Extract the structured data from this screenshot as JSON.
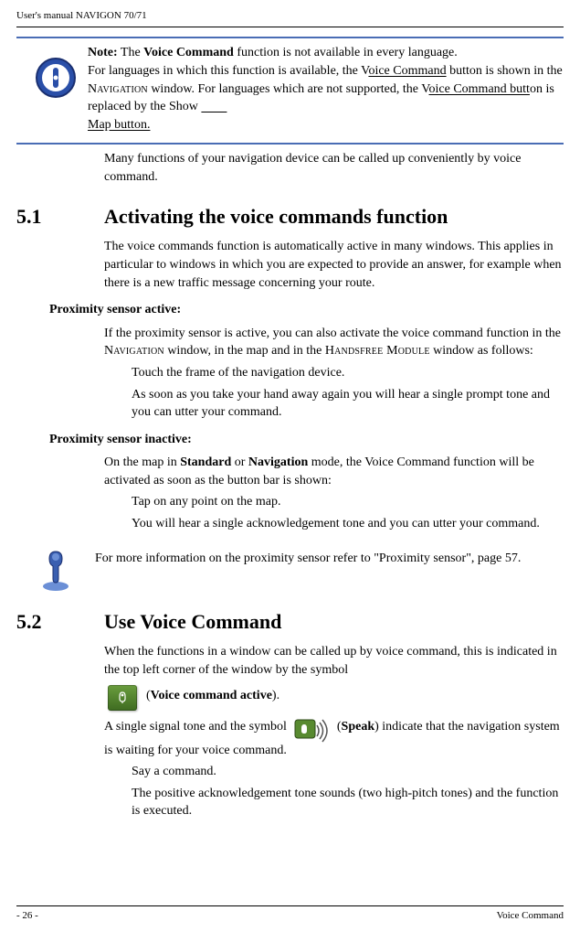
{
  "header": {
    "title": "User's manual NAVIGON 70/71"
  },
  "note": {
    "line1_prefix": "Note:",
    "line1_rest_a": " The ",
    "line1_bold": "Voice Command",
    "line1_rest_b": " function is not available in every language.",
    "line2_a": "For languages in which this function is available, the V",
    "line2_u1": "oice Command",
    "line2_b": " button is shown in the ",
    "line2_sc": "Navigation",
    "line2_c": " window. For languages which are not supported, the V",
    "line2_u2": "oice Command butt",
    "line2_d": "on is replaced by the Show ",
    "line2_spaces": "        ",
    "line2_u3": "Map button."
  },
  "intro_para": "Many functions of your navigation device can be called up conveniently by voice command.",
  "sections": [
    {
      "num": "5.1",
      "title": "Activating the voice commands function",
      "para1": "The voice commands function is automatically active in many windows. This applies in particular to windows in which you are expected to provide an answer, for example when there is a new traffic message concerning your route.",
      "sub1_heading": "Proximity sensor active:",
      "sub1_p1_a": "If the proximity sensor is active, you can also activate the voice command function in the ",
      "sub1_sc1": "Navigation",
      "sub1_p1_b": " window, in the map and in the ",
      "sub1_sc2": "Handsfree Module",
      "sub1_p1_c": " window as follows:",
      "sub1_step1": "Touch the frame of the navigation device.",
      "sub1_step2": "As soon as you take your hand away again you will hear a single prompt tone and you can utter your command.",
      "sub2_heading": "Proximity sensor inactive:",
      "sub2_p1_a": "On the map in ",
      "sub2_bold1": "Standard",
      "sub2_p1_b": " or ",
      "sub2_bold2": "Navigation",
      "sub2_p1_c": " mode, the Voice Command function will be activated as soon as the button bar is shown:",
      "sub2_step1": "Tap on any point on the map.",
      "sub2_step2": "You will hear a single acknowledgement tone and you can utter your command.",
      "info_text": "For more information on the proximity sensor refer to \"Proximity sensor\", page 57."
    },
    {
      "num": "5.2",
      "title": "Use Voice Command",
      "p1": "When the functions in a window can be called up by voice command, this is indicated in the top left corner of the window by the symbol",
      "icon1_label": "Voice command active",
      "p2_a": "A single signal tone and the symbol ",
      "p2_b": " (",
      "icon2_label": "Speak",
      "p2_c": ") indicate that the navigation system is waiting for your voice command.",
      "step1": "Say a command.",
      "step2": "The positive acknowledgement tone sounds (two high-pitch tones) and the function is executed."
    }
  ],
  "footer": {
    "page": "- 26 -",
    "chapter": "Voice Command"
  }
}
